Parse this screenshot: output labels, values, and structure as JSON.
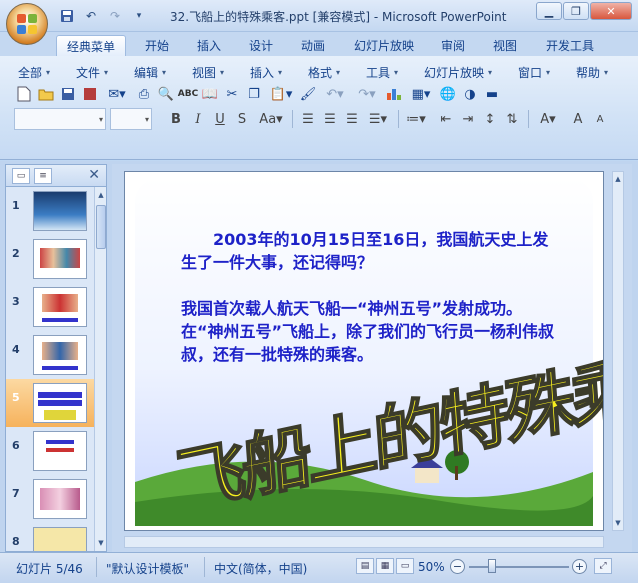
{
  "window": {
    "title": "32.飞船上的特殊乘客.ppt [兼容模式] - Microsoft PowerPoint",
    "minimize_icon": "minimize-icon",
    "restore_icon": "restore-icon",
    "close_icon": "close-icon"
  },
  "quick_access": [
    "save-icon",
    "undo-icon",
    "redo-icon",
    "customize-icon"
  ],
  "ribbon_tabs": [
    {
      "label": "经典菜单",
      "active": true
    },
    {
      "label": "开始"
    },
    {
      "label": "插入"
    },
    {
      "label": "设计"
    },
    {
      "label": "动画"
    },
    {
      "label": "幻灯片放映"
    },
    {
      "label": "审阅"
    },
    {
      "label": "视图"
    },
    {
      "label": "开发工具"
    }
  ],
  "menus": [
    "全部",
    "文件",
    "编辑",
    "视图",
    "插入",
    "格式",
    "工具",
    "幻灯片放映",
    "窗口",
    "帮助"
  ],
  "slide_panel": {
    "tab_slides_icon": "slides-tab-icon",
    "tab_outline_icon": "outline-tab-icon",
    "close_label": "✕",
    "selected": 5,
    "thumbs": [
      {
        "num": "1"
      },
      {
        "num": "2"
      },
      {
        "num": "3"
      },
      {
        "num": "4"
      },
      {
        "num": "5"
      },
      {
        "num": "6"
      },
      {
        "num": "7"
      },
      {
        "num": "8"
      }
    ]
  },
  "slide": {
    "paragraph1": "2003年的10月15日至16日，我国航天史上发生了一件大事，还记得吗？",
    "paragraph2": "我国首次载人航天飞船一“神州五号”发射成功。在“神州五号”飞船上，除了我们的飞行员一杨利伟叔叔，还有一批特殊的乘客。",
    "wordart": "飞船上的特殊乘客"
  },
  "status": {
    "slide_info": "幻灯片 5/46",
    "theme": "\"默认设计模板\"",
    "language": "中文(简体，中国)",
    "zoom": "50%"
  },
  "colors": {
    "slide_text": "#1e22c8",
    "wordart_fill": "#f7f01e",
    "selected_thumb": "#f6b25c"
  }
}
